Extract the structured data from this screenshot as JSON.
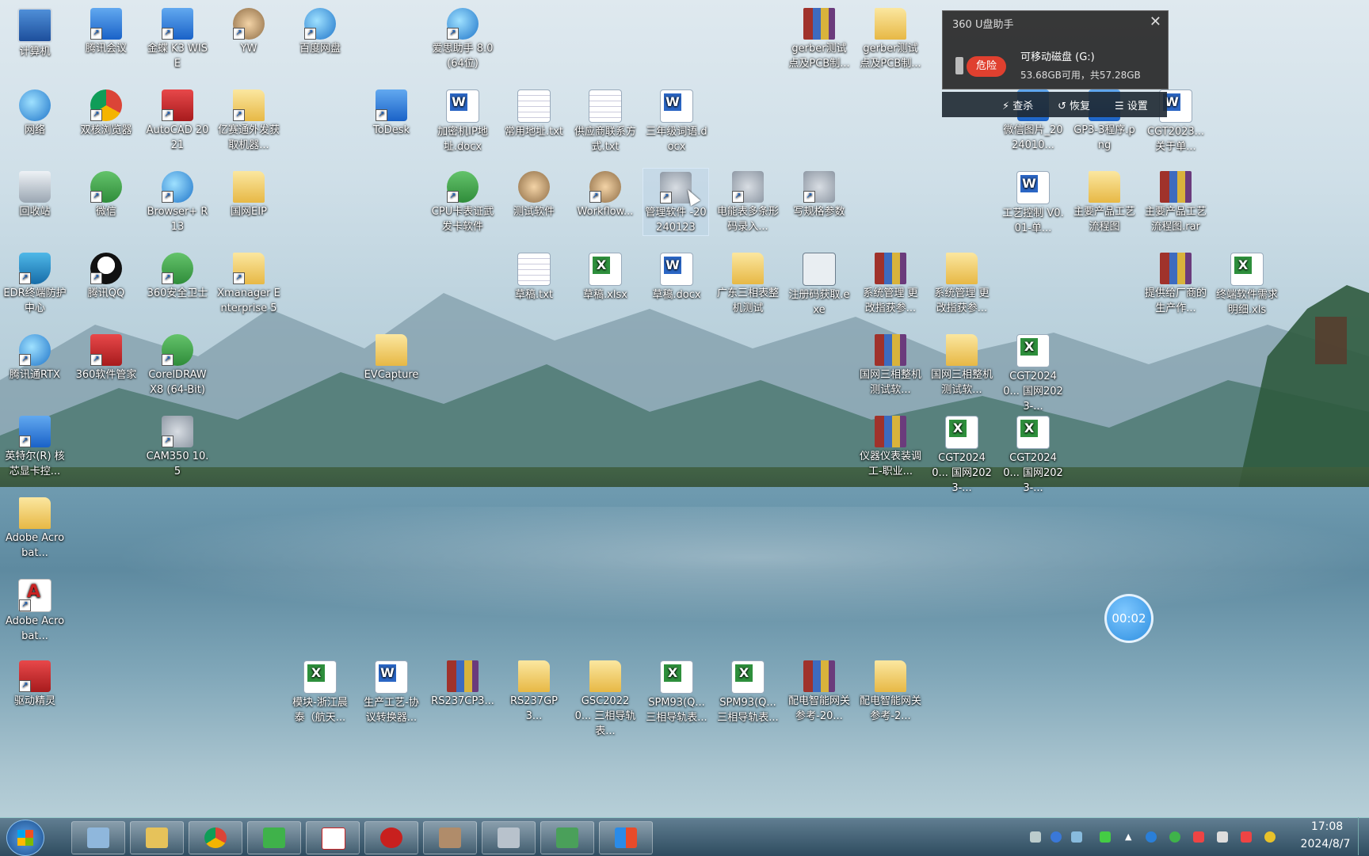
{
  "desktop": {
    "icons": [
      {
        "label": "计算机",
        "icon": "computer-icon"
      },
      {
        "label": "腾讯会议",
        "icon": "tencent-meeting-icon"
      },
      {
        "label": "金蝶 K3 WISE",
        "icon": "kingdee-icon"
      },
      {
        "label": "YW",
        "icon": "user-tool-icon"
      },
      {
        "label": "百度网盘",
        "icon": "baidu-netdisk-icon"
      },
      {
        "label": "爱思助手 8.0(64位)",
        "icon": "i4-assistant-icon"
      },
      {
        "label": "gerber测试点及PCB制...",
        "icon": "winrar-icon"
      },
      {
        "label": "gerber测试点及PCB制...",
        "icon": "folder-icon"
      },
      {
        "label": "网络",
        "icon": "network-icon"
      },
      {
        "label": "双核浏览器",
        "icon": "browser-icon"
      },
      {
        "label": "AutoCAD 2021",
        "icon": "autocad-icon"
      },
      {
        "label": "亿赛通外发获取机器...",
        "icon": "folder-tool-icon"
      },
      {
        "label": "ToDesk",
        "icon": "todesk-icon"
      },
      {
        "label": "加密机IP地址.docx",
        "icon": "word-icon"
      },
      {
        "label": "常用地址.txt",
        "icon": "text-file-icon"
      },
      {
        "label": "供应商联系方式.txt",
        "icon": "text-file-icon"
      },
      {
        "label": "三年级词语.docx",
        "icon": "word-icon"
      },
      {
        "label": "微信图片_2024010...",
        "icon": "image-icon"
      },
      {
        "label": "GP3-3程序.png",
        "icon": "image-icon"
      },
      {
        "label": "CGT2023... 关于单...",
        "icon": "word-icon"
      },
      {
        "label": "回收站",
        "icon": "recycle-bin-icon"
      },
      {
        "label": "微信",
        "icon": "wechat-icon"
      },
      {
        "label": "Browser+ R13",
        "icon": "browser-plus-icon"
      },
      {
        "label": "国网EIP",
        "icon": "folder-icon"
      },
      {
        "label": "CPU卡表证武发卡软件",
        "icon": "cpu-card-icon"
      },
      {
        "label": "测试软件",
        "icon": "people-icon"
      },
      {
        "label": "Workflow...",
        "icon": "workflow-icon"
      },
      {
        "label": "管理软件 -20240123",
        "icon": "tools-icon"
      },
      {
        "label": "电能表多条形码录入...",
        "icon": "tools-icon"
      },
      {
        "label": "写规格参数",
        "icon": "tools-icon"
      },
      {
        "label": "工艺控制 V0.01-单...",
        "icon": "word-icon"
      },
      {
        "label": "主要产品工艺流程图",
        "icon": "folder-icon"
      },
      {
        "label": "主要产品工艺流程图.rar",
        "icon": "winrar-icon"
      },
      {
        "label": "EDR终端防护中心",
        "icon": "shield-icon"
      },
      {
        "label": "腾讯QQ",
        "icon": "qq-icon"
      },
      {
        "label": "360安全卫士",
        "icon": "security-360-icon"
      },
      {
        "label": "Xmanager Enterprise 5",
        "icon": "xmanager-icon"
      },
      {
        "label": "草稿.txt",
        "icon": "text-file-icon"
      },
      {
        "label": "草稿.xlsx",
        "icon": "excel-icon"
      },
      {
        "label": "草稿.docx",
        "icon": "word-icon"
      },
      {
        "label": "广东三相表整机测试",
        "icon": "folder-icon"
      },
      {
        "label": "注册码获取.exe",
        "icon": "exe-icon"
      },
      {
        "label": "系统管理 更改指获参...",
        "icon": "winrar-icon"
      },
      {
        "label": "系统管理 更改指获参...",
        "icon": "folder-icon"
      },
      {
        "label": "提供给厂商的 生产作...",
        "icon": "winrar-icon"
      },
      {
        "label": "终端软件需求明细.xls",
        "icon": "excel-icon"
      },
      {
        "label": "腾讯通RTX",
        "icon": "rtx-icon"
      },
      {
        "label": "360软件管家",
        "icon": "software-manager-icon"
      },
      {
        "label": "CorelDRAW X8 (64-Bit)",
        "icon": "coreldraw-icon"
      },
      {
        "label": "EVCapture",
        "icon": "folder-icon"
      },
      {
        "label": "国网三相整机测试软...",
        "icon": "winrar-icon"
      },
      {
        "label": "国网三相整机测试软...",
        "icon": "folder-icon"
      },
      {
        "label": "CGT20240... 国网2023-...",
        "icon": "excel-icon"
      },
      {
        "label": "英特尔(R) 核芯显卡控...",
        "icon": "intel-graphics-icon"
      },
      {
        "label": "CAM350 10.5",
        "icon": "cam350-icon"
      },
      {
        "label": "仪器仪表装调工-职业...",
        "icon": "winrar-icon"
      },
      {
        "label": "CGT20240... 国网2023-...",
        "icon": "excel-icon"
      },
      {
        "label": "CGT20240... 国网2023-...",
        "icon": "excel-icon"
      },
      {
        "label": "Adobe Acrobat...",
        "icon": "folder-icon"
      },
      {
        "label": "Adobe Acrobat...",
        "icon": "acrobat-icon"
      },
      {
        "label": "驱动精灵",
        "icon": "driver-genius-icon"
      },
      {
        "label": "模块-浙江晨泰（航天...",
        "icon": "excel-icon"
      },
      {
        "label": "生产工艺-协议转换器...",
        "icon": "word-icon"
      },
      {
        "label": "RS237CP3...",
        "icon": "winrar-icon"
      },
      {
        "label": "RS237GP3...",
        "icon": "folder-icon"
      },
      {
        "label": "GSC20220... 三相导轨表...",
        "icon": "folder-icon"
      },
      {
        "label": "SPM93(Q... 三相导轨表...",
        "icon": "excel-icon"
      },
      {
        "label": "SPM93(Q... 三相导轨表...",
        "icon": "excel-icon"
      },
      {
        "label": "配电智能网关参考-20...",
        "icon": "winrar-icon"
      },
      {
        "label": "配电智能网关参考-2...",
        "icon": "folder-icon"
      }
    ]
  },
  "popup360": {
    "title": "360 U盘助手",
    "danger_label": "危险",
    "drive_name": "可移动磁盘 (G:)",
    "space_text": "53.68GB可用，共57.28GB",
    "actions": {
      "scan": "查杀",
      "restore": "恢复",
      "settings": "设置"
    }
  },
  "recording_timer": "00:02",
  "taskbar": {
    "apps": [
      "search-tool-icon",
      "file-explorer-icon",
      "chrome-icon",
      "wechat-icon",
      "acrobat-icon",
      "risesun-icon",
      "workflow-icon",
      "tools-icon",
      "wechat-screenshot-icon",
      "office-icon"
    ],
    "clock_time": "17:08",
    "clock_date": "2024/8/7"
  }
}
